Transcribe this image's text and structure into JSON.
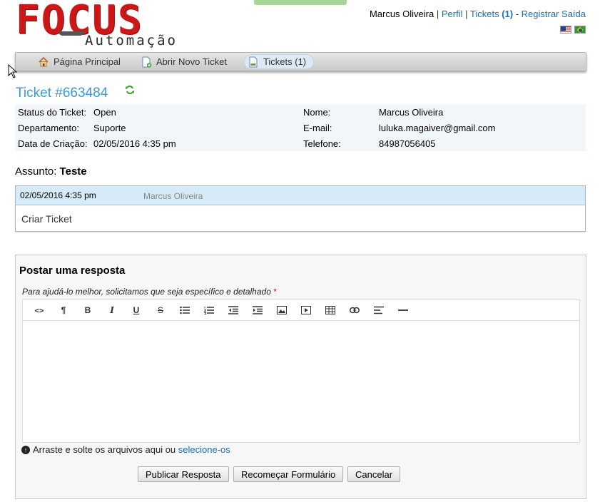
{
  "header": {
    "logo_word": "FOCUS",
    "logo_sub": "Automação",
    "user_name": "Marcus Oliveira",
    "profile_link": "Perfil",
    "tickets_link": "Tickets",
    "tickets_count": "(1)",
    "logout_link": "Registrar Saída",
    "flags": [
      "us-flag-icon",
      "br-flag-icon"
    ]
  },
  "nav": {
    "items": [
      {
        "label": "Página Principal",
        "icon": "home-icon"
      },
      {
        "label": "Abrir Novo Ticket",
        "icon": "new-ticket-icon"
      },
      {
        "label": "Tickets (1)",
        "icon": "tickets-icon",
        "active": true
      }
    ]
  },
  "ticket": {
    "title": "Ticket #663484",
    "status_label": "Status do Ticket:",
    "status_value": "Open",
    "department_label": "Departamento:",
    "department_value": "Suporte",
    "created_label": "Data de Criação:",
    "created_value": "02/05/2016 4:35 pm",
    "name_label": "Nome:",
    "name_value": "Marcus Oliveira",
    "email_label": "E-mail:",
    "email_value": "luluka.magaiver@gmail.com",
    "phone_label": "Telefone:",
    "phone_value": "84987056405"
  },
  "subject": {
    "label": "Assunto:",
    "value": "Teste"
  },
  "thread": {
    "date": "02/05/2016 4:35 pm",
    "author": "Marcus Oliveira",
    "body": "Criar Ticket"
  },
  "reply": {
    "title": "Postar uma resposta",
    "hint": "Para ajudá-lo melhor, solicitamos que seja específico e detalhado",
    "required_mark": "*",
    "toolbar": [
      "<>",
      "¶",
      "B",
      "I",
      "U",
      "S",
      "ul",
      "ol",
      "outdent",
      "indent",
      "image",
      "video",
      "table",
      "link",
      "align",
      "hr"
    ],
    "attach_text": "Arraste e solte os arquivos aqui ou",
    "attach_link": "selecione-os",
    "submit_label": "Publicar Resposta",
    "reset_label": "Recomeçar Formulário",
    "cancel_label": "Cancelar"
  },
  "colors": {
    "accent": "#3a9ad9",
    "logo_red": "#cc1719",
    "link": "#1b6fb5",
    "thread_header": "#d6eaf8"
  }
}
